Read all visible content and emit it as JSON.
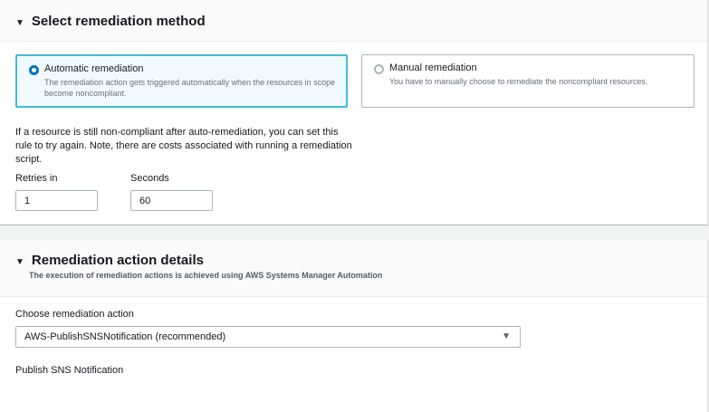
{
  "method": {
    "title": "Select remediation method",
    "options": [
      {
        "label": "Automatic remediation",
        "description": "The remediation action gets triggered automatically when the resources in scope become noncompliant.",
        "selected": true
      },
      {
        "label": "Manual remediation",
        "description": "You have to manually choose to remediate the noncompliant resources.",
        "selected": false
      }
    ],
    "note": "If a resource is still non-compliant after auto-remediation, you can set this rule to try again. Note, there are costs associated with running a remediation script.",
    "retries_label": "Retries in",
    "retries_value": "1",
    "seconds_label": "Seconds",
    "seconds_value": "60"
  },
  "action": {
    "title": "Remediation action details",
    "subtitle": "The execution of remediation actions is achieved using AWS Systems Manager Automation",
    "choose_label": "Choose remediation action",
    "selected_action": "AWS-PublishSNSNotification (recommended)",
    "section_label": "Publish SNS Notification"
  }
}
